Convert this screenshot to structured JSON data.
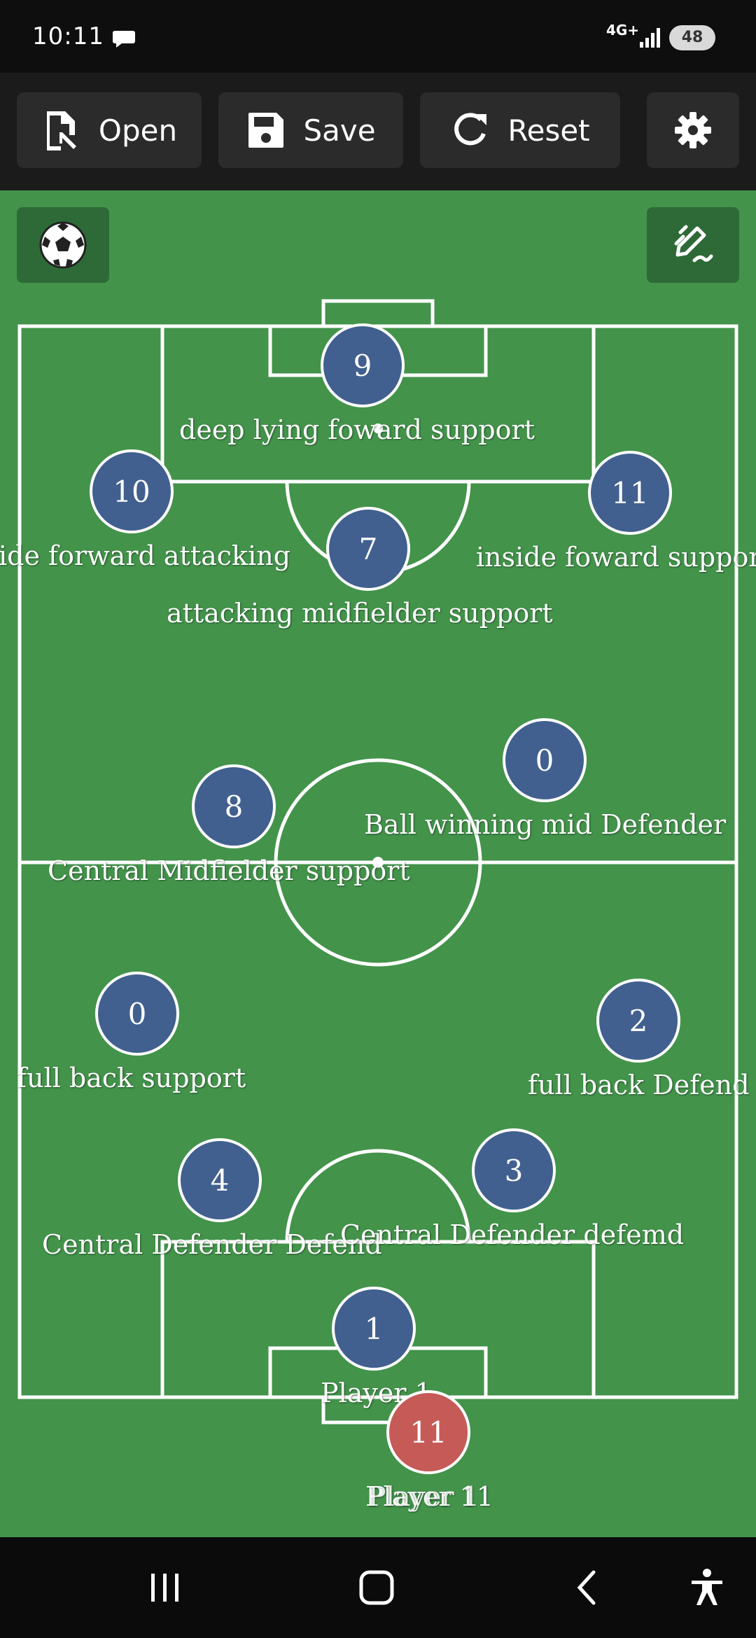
{
  "status_bar": {
    "time": "10:11",
    "network": "4G+",
    "battery": "48"
  },
  "toolbar": {
    "open_label": "Open",
    "save_label": "Save",
    "reset_label": "Reset"
  },
  "icons": {
    "open": "file-open-icon",
    "save": "floppy-disk-icon",
    "reset": "refresh-icon",
    "settings": "gear-icon",
    "ball": "soccer-ball-icon",
    "edit": "pencil-edit-icon"
  },
  "colors": {
    "pitch": "#43934b",
    "player_blue": "#41608f",
    "player_red": "#c65a57"
  },
  "players": [
    {
      "number": "9",
      "label": "deep lying foward support",
      "team": "blue"
    },
    {
      "number": "10",
      "label": "ide forward attacking",
      "team": "blue"
    },
    {
      "number": "11",
      "label": "inside foward suppor",
      "team": "blue"
    },
    {
      "number": "7",
      "label": "attacking midfielder support",
      "team": "blue"
    },
    {
      "number": "0",
      "label": "Ball winning mid Defender",
      "team": "blue"
    },
    {
      "number": "8",
      "label": "Central Midfielder support",
      "team": "blue"
    },
    {
      "number": "0",
      "label": "full back support",
      "team": "blue"
    },
    {
      "number": "2",
      "label": "full back Defend",
      "team": "blue"
    },
    {
      "number": "4",
      "label": "Central Defender Defend",
      "team": "blue"
    },
    {
      "number": "3",
      "label": "Central Defender defemd",
      "team": "blue"
    },
    {
      "number": "1",
      "label": "Player 1",
      "team": "blue"
    },
    {
      "number": "11",
      "label": "Player 11",
      "team": "red"
    }
  ],
  "overlap_label": "Player 1"
}
